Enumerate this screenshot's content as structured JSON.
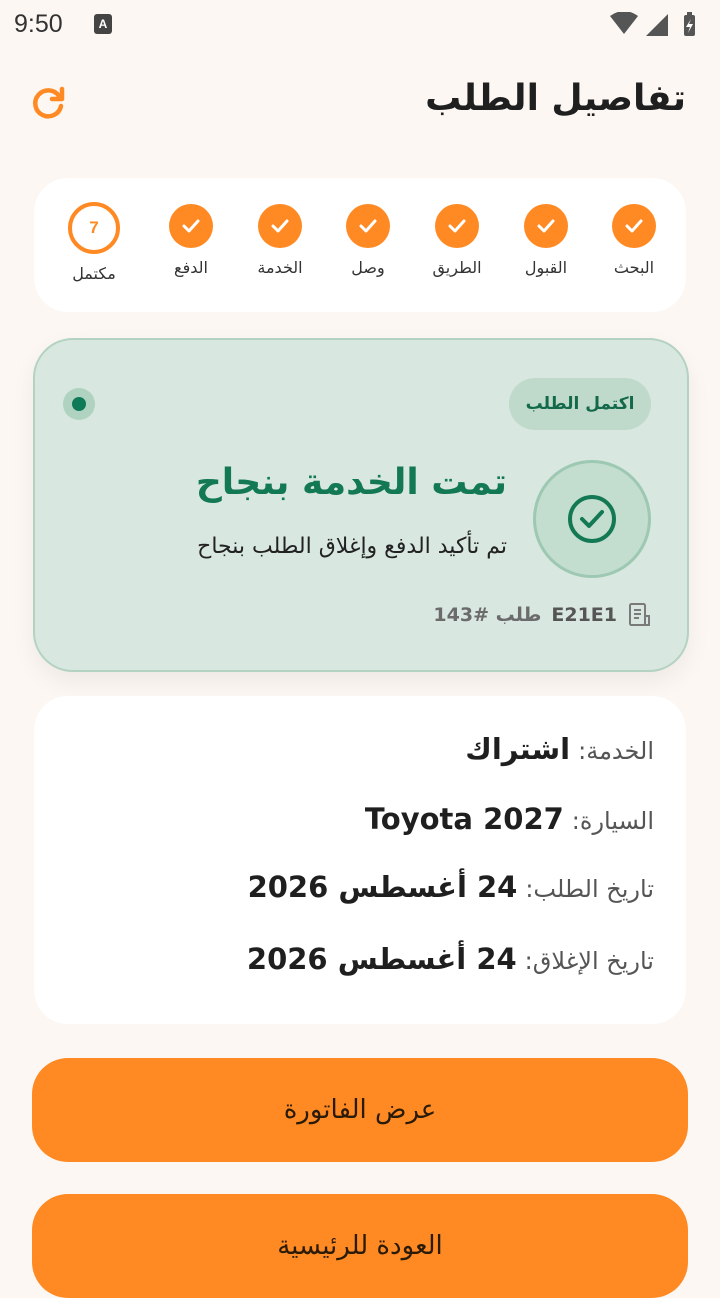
{
  "status_bar": {
    "time": "9:50",
    "indicator": "A"
  },
  "header": {
    "title": "تفاصيل الطلب",
    "refresh_icon": "refresh-icon"
  },
  "progress": {
    "steps": [
      {
        "label": "البحث",
        "state": "done"
      },
      {
        "label": "القبول",
        "state": "done"
      },
      {
        "label": "الطريق",
        "state": "done"
      },
      {
        "label": "وصل",
        "state": "done"
      },
      {
        "label": "الخدمة",
        "state": "done"
      },
      {
        "label": "الدفع",
        "state": "done"
      },
      {
        "label": "مكتمل",
        "state": "current",
        "number": "7"
      }
    ]
  },
  "success": {
    "status_pill": "اكتمل الطلب",
    "title": "تمت الخدمة بنجاح",
    "subtitle": "تم تأكيد الدفع وإغلاق الطلب بنجاح",
    "order_code": "E21E1",
    "order_number": "طلب #143"
  },
  "details": {
    "service_label": "الخدمة:",
    "service_value": "اشتراك",
    "car_label": "السيارة:",
    "car_value": "Toyota 2027",
    "order_date_label": "تاريخ الطلب:",
    "order_date_value": "24 أغسطس 2026",
    "close_date_label": "تاريخ الإغلاق:",
    "close_date_value": "24 أغسطس 2026"
  },
  "buttons": {
    "invoice": "عرض الفاتورة",
    "home": "العودة للرئيسية"
  },
  "colors": {
    "accent": "#FF8A23",
    "success": "#137955",
    "success_bg": "#D8E7DF",
    "background": "#FCF7F3"
  }
}
